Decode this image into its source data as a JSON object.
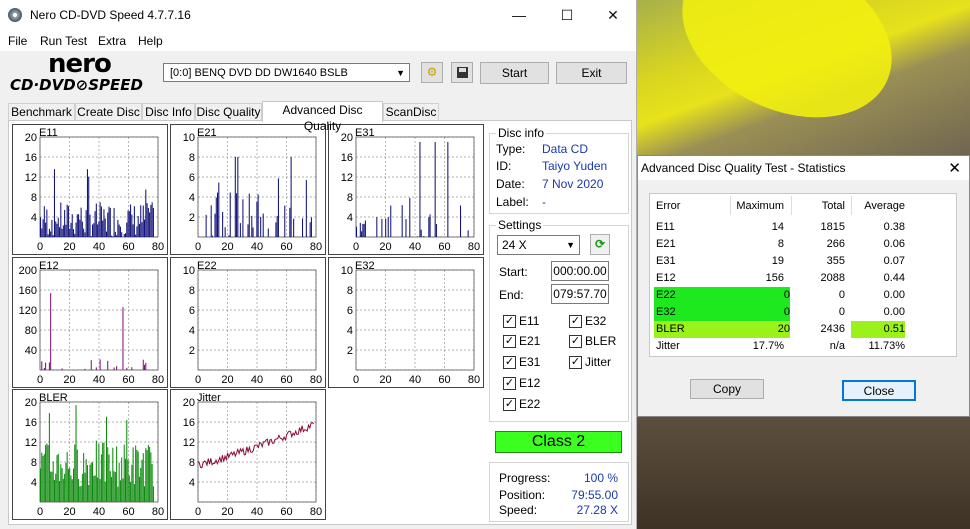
{
  "main_window": {
    "title": "Nero CD-DVD Speed 4.7.7.16",
    "controls": {
      "minimize": "—",
      "maximize": "☐",
      "close": "✕"
    }
  },
  "menu": [
    "File",
    "Run Test",
    "Extra",
    "Help"
  ],
  "toolbar": {
    "logo_top": "nero",
    "logo_bottom": "CD·DVD⊘SPEED",
    "drive": "[0:0]   BENQ DVD DD DW1640 BSLB",
    "start_label": "Start",
    "exit_label": "Exit"
  },
  "tabs": [
    "Benchmark",
    "Create Disc",
    "Disc Info",
    "Disc Quality",
    "Advanced Disc Quality",
    "ScanDisc"
  ],
  "active_tab": "Advanced Disc Quality",
  "charts": {
    "x_ticks": [
      "0",
      "20",
      "40",
      "60",
      "80"
    ],
    "items": [
      {
        "name": "E11",
        "yticks": [
          "20",
          "16",
          "12",
          "8",
          "4"
        ],
        "ymax": 20,
        "color": "#10107a"
      },
      {
        "name": "E21",
        "yticks": [
          "10",
          "8",
          "6",
          "4",
          "2"
        ],
        "ymax": 10,
        "color": "#10107a"
      },
      {
        "name": "E31",
        "yticks": [
          "20",
          "16",
          "12",
          "8",
          "4"
        ],
        "ymax": 20,
        "color": "#10107a"
      },
      {
        "name": "E12",
        "yticks": [
          "200",
          "160",
          "120",
          "80",
          "40"
        ],
        "ymax": 200,
        "color": "#80107a"
      },
      {
        "name": "E22",
        "yticks": [
          "10",
          "8",
          "6",
          "4",
          "2"
        ],
        "ymax": 10,
        "color": "#10107a"
      },
      {
        "name": "E32",
        "yticks": [
          "10",
          "8",
          "6",
          "4",
          "2"
        ],
        "ymax": 10,
        "color": "#10107a"
      },
      {
        "name": "BLER",
        "yticks": [
          "20",
          "16",
          "12",
          "8",
          "4"
        ],
        "ymax": 20,
        "color": "#0a8a0a"
      },
      {
        "name": "Jitter",
        "yticks": [
          "20",
          "16",
          "12",
          "8",
          "4"
        ],
        "ymax": 20,
        "color": "#8a0a3a"
      }
    ]
  },
  "disc_info": {
    "label": "Disc info",
    "type_label": "Type:",
    "type_value": "Data CD",
    "id_label": "ID:",
    "id_value": "Taiyo Yuden",
    "date_label": "Date:",
    "date_value": "7 Nov 2020",
    "label_label": "Label:",
    "label_value": "-"
  },
  "settings": {
    "label": "Settings",
    "speed": "24 X",
    "start_label": "Start:",
    "start_value": "000:00.00",
    "end_label": "End:",
    "end_value": "079:57.70",
    "checkboxes": [
      {
        "label": "E11",
        "checked": true
      },
      {
        "label": "E32",
        "checked": true
      },
      {
        "label": "E21",
        "checked": true
      },
      {
        "label": "BLER",
        "checked": true
      },
      {
        "label": "E31",
        "checked": true
      },
      {
        "label": "Jitter",
        "checked": true
      },
      {
        "label": "E12",
        "checked": true
      },
      {
        "label": "E22",
        "checked": true
      }
    ]
  },
  "class_label": "Class 2",
  "progress": {
    "progress_label": "Progress:",
    "progress_value": "100 %",
    "position_label": "Position:",
    "position_value": "79:55.00",
    "speed_label": "Speed:",
    "speed_value": "27.28 X"
  },
  "stats_dialog": {
    "title": "Advanced Disc Quality Test - Statistics",
    "close_x": "✕",
    "headers": [
      "Error",
      "Maximum",
      "Total",
      "Average"
    ],
    "rows": [
      {
        "error": "E11",
        "maximum": "14",
        "total": "1815",
        "average": "0.38",
        "highlight": ""
      },
      {
        "error": "E21",
        "maximum": "8",
        "total": "266",
        "average": "0.06",
        "highlight": ""
      },
      {
        "error": "E31",
        "maximum": "19",
        "total": "355",
        "average": "0.07",
        "highlight": ""
      },
      {
        "error": "E12",
        "maximum": "156",
        "total": "2088",
        "average": "0.44",
        "highlight": ""
      },
      {
        "error": "E22",
        "maximum": "0",
        "total": "0",
        "average": "0.00",
        "highlight": "#1ee81e"
      },
      {
        "error": "E32",
        "maximum": "0",
        "total": "0",
        "average": "0.00",
        "highlight": "#1ee81e"
      },
      {
        "error": "BLER",
        "maximum": "20",
        "total": "2436",
        "average": "0.51",
        "highlight": "#9af21a"
      },
      {
        "error": "Jitter",
        "maximum": "17.7%",
        "total": "n/a",
        "average": "11.73%",
        "highlight": ""
      }
    ],
    "copy_label": "Copy",
    "close_label": "Close"
  }
}
